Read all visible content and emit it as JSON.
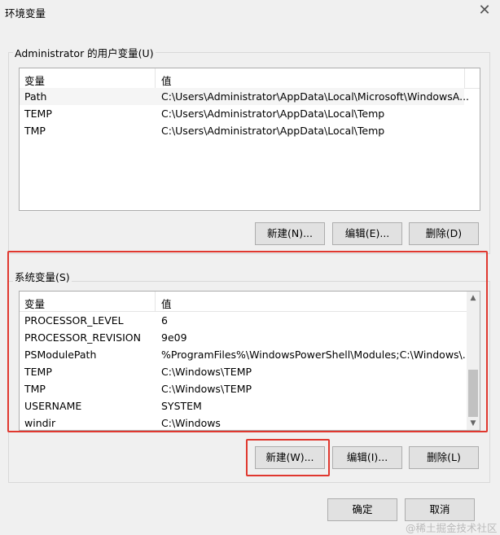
{
  "window": {
    "title": "环境变量",
    "close_glyph": "✕"
  },
  "user_vars": {
    "group_label": "Administrator 的用户变量(U)",
    "headers": [
      "变量",
      "值"
    ],
    "rows": [
      {
        "name": "Path",
        "value": "C:\\Users\\Administrator\\AppData\\Local\\Microsoft\\WindowsA..."
      },
      {
        "name": "TEMP",
        "value": "C:\\Users\\Administrator\\AppData\\Local\\Temp"
      },
      {
        "name": "TMP",
        "value": "C:\\Users\\Administrator\\AppData\\Local\\Temp"
      }
    ],
    "buttons": {
      "new": "新建(N)...",
      "edit": "编辑(E)...",
      "delete": "删除(D)"
    }
  },
  "system_vars": {
    "group_label": "系统变量(S)",
    "headers": [
      "变量",
      "值"
    ],
    "rows": [
      {
        "name": "PROCESSOR_LEVEL",
        "value": "6"
      },
      {
        "name": "PROCESSOR_REVISION",
        "value": "9e09"
      },
      {
        "name": "PSModulePath",
        "value": "%ProgramFiles%\\WindowsPowerShell\\Modules;C:\\Windows\\..."
      },
      {
        "name": "TEMP",
        "value": "C:\\Windows\\TEMP"
      },
      {
        "name": "TMP",
        "value": "C:\\Windows\\TEMP"
      },
      {
        "name": "USERNAME",
        "value": "SYSTEM"
      },
      {
        "name": "windir",
        "value": "C:\\Windows"
      }
    ],
    "buttons": {
      "new": "新建(W)...",
      "edit": "编辑(I)...",
      "delete": "删除(L)"
    },
    "scroll_up": "▲",
    "scroll_down": "▼"
  },
  "footer": {
    "ok": "确定",
    "cancel": "取消"
  },
  "watermark": "@稀土掘金技术社区",
  "colors": {
    "highlight": "#e0382f",
    "button_bg": "#e1e1e1",
    "dialog_bg": "#f0f0f0"
  }
}
